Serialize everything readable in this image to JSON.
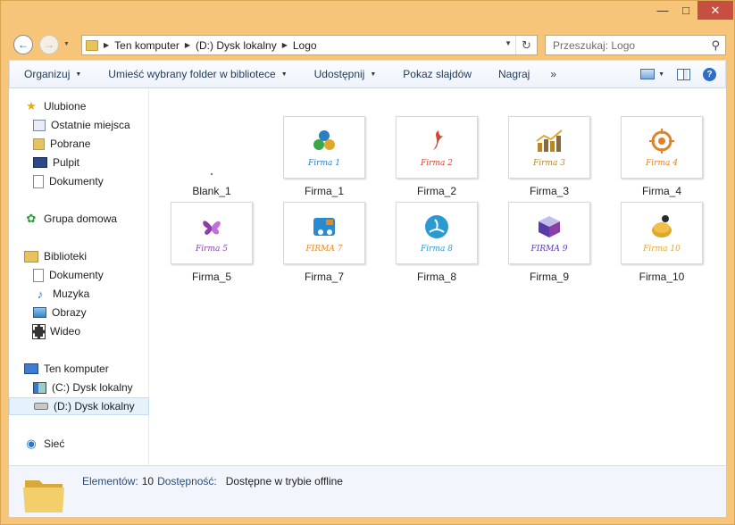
{
  "window": {
    "minimize_icon": "minimize-icon",
    "maximize_icon": "maximize-icon",
    "close_icon": "close-icon"
  },
  "address": {
    "crumbs": [
      "Ten komputer",
      "(D:) Dysk lokalny",
      "Logo"
    ],
    "search_placeholder": "Przeszukaj: Logo"
  },
  "toolbar": {
    "organize": "Organizuj",
    "add_to_library": "Umieść wybrany folder w bibliotece",
    "share": "Udostępnij",
    "slideshow": "Pokaz slajdów",
    "burn": "Nagraj",
    "more": "»"
  },
  "nav": {
    "favorites": "Ulubione",
    "recent": "Ostatnie miejsca",
    "downloads": "Pobrane",
    "desktop": "Pulpit",
    "documents_fav": "Dokumenty",
    "homegroup": "Grupa domowa",
    "libraries": "Biblioteki",
    "lib_documents": "Dokumenty",
    "music": "Muzyka",
    "pictures": "Obrazy",
    "videos": "Wideo",
    "this_pc": "Ten komputer",
    "c_drive": "(C:) Dysk lokalny",
    "d_drive": "(D:) Dysk lokalny",
    "network": "Sieć"
  },
  "files": [
    {
      "name": "Blank_1",
      "logo_text": "",
      "color": "#777777"
    },
    {
      "name": "Firma_1",
      "logo_text": "Firma 1",
      "color": "#2a7fc4"
    },
    {
      "name": "Firma_2",
      "logo_text": "Firma 2",
      "color": "#d2452f"
    },
    {
      "name": "Firma_3",
      "logo_text": "Firma 3",
      "color": "#b8862a"
    },
    {
      "name": "Firma_4",
      "logo_text": "Firma 4",
      "color": "#e0822a"
    },
    {
      "name": "Firma_5",
      "logo_text": "Firma 5",
      "color": "#8a3fa8"
    },
    {
      "name": "Firma_7",
      "logo_text": "FIRMA 7",
      "color": "#e08a2a"
    },
    {
      "name": "Firma_8",
      "logo_text": "Firma 8",
      "color": "#2a9ad0"
    },
    {
      "name": "Firma_9",
      "logo_text": "FIRMA 9",
      "color": "#5a3aa8"
    },
    {
      "name": "Firma_10",
      "logo_text": "Firma 10",
      "color": "#e0a82a"
    }
  ],
  "details": {
    "items_label": "Elementów:",
    "items_value": "10",
    "availability_label": "Dostępność:",
    "availability_value": "Dostępne w trybie offline"
  }
}
